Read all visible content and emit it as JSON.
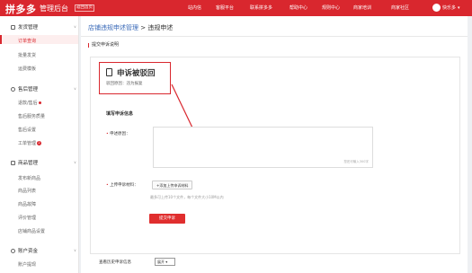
{
  "header": {
    "logo": "拼多多",
    "subtitle": "管理后台",
    "home_button": "返回首页",
    "nav": [
      "站内信",
      "客服平台",
      "联系拼多多",
      "帮助中心",
      "规则中心",
      "商家培训",
      "商家社区"
    ],
    "user_name": "快乐多"
  },
  "sidebar": {
    "groups": [
      {
        "label": "发货管理",
        "items": [
          "订单查询",
          "批量发货",
          "运费模板"
        ]
      },
      {
        "label": "售后管理",
        "items": [
          "退款/售后",
          "售后服务质量",
          "售后设置",
          "工单管理"
        ]
      },
      {
        "label": "商品管理",
        "items": [
          "发布新商品",
          "商品列表",
          "商品故障",
          "评价管理",
          "店铺商品设置"
        ]
      },
      {
        "label": "账户资金",
        "items": [
          "账户提现"
        ]
      }
    ],
    "active_item": "订单查询",
    "ticket_badge": "2"
  },
  "main": {
    "breadcrumb_link": "店铺违规申述管理",
    "breadcrumb_sep": ">",
    "breadcrumb_current": "违规申述",
    "section_title": "提交申诉说明",
    "status_title": "申诉被驳回",
    "status_reason": "驳回原因：违为报复",
    "form_title": "填写申诉信息",
    "reason_label": "申述原因：",
    "reason_placeholder": "您还可输入300字",
    "materials_label": "上传申诉材料：",
    "upload_button": "+添加上传申诉材料",
    "upload_hint": "最多可上传10个文件，每个文件大小10M以内",
    "submit_button": "提交申诉",
    "history_label": "查看历史申诉信息",
    "history_select": "展开"
  }
}
